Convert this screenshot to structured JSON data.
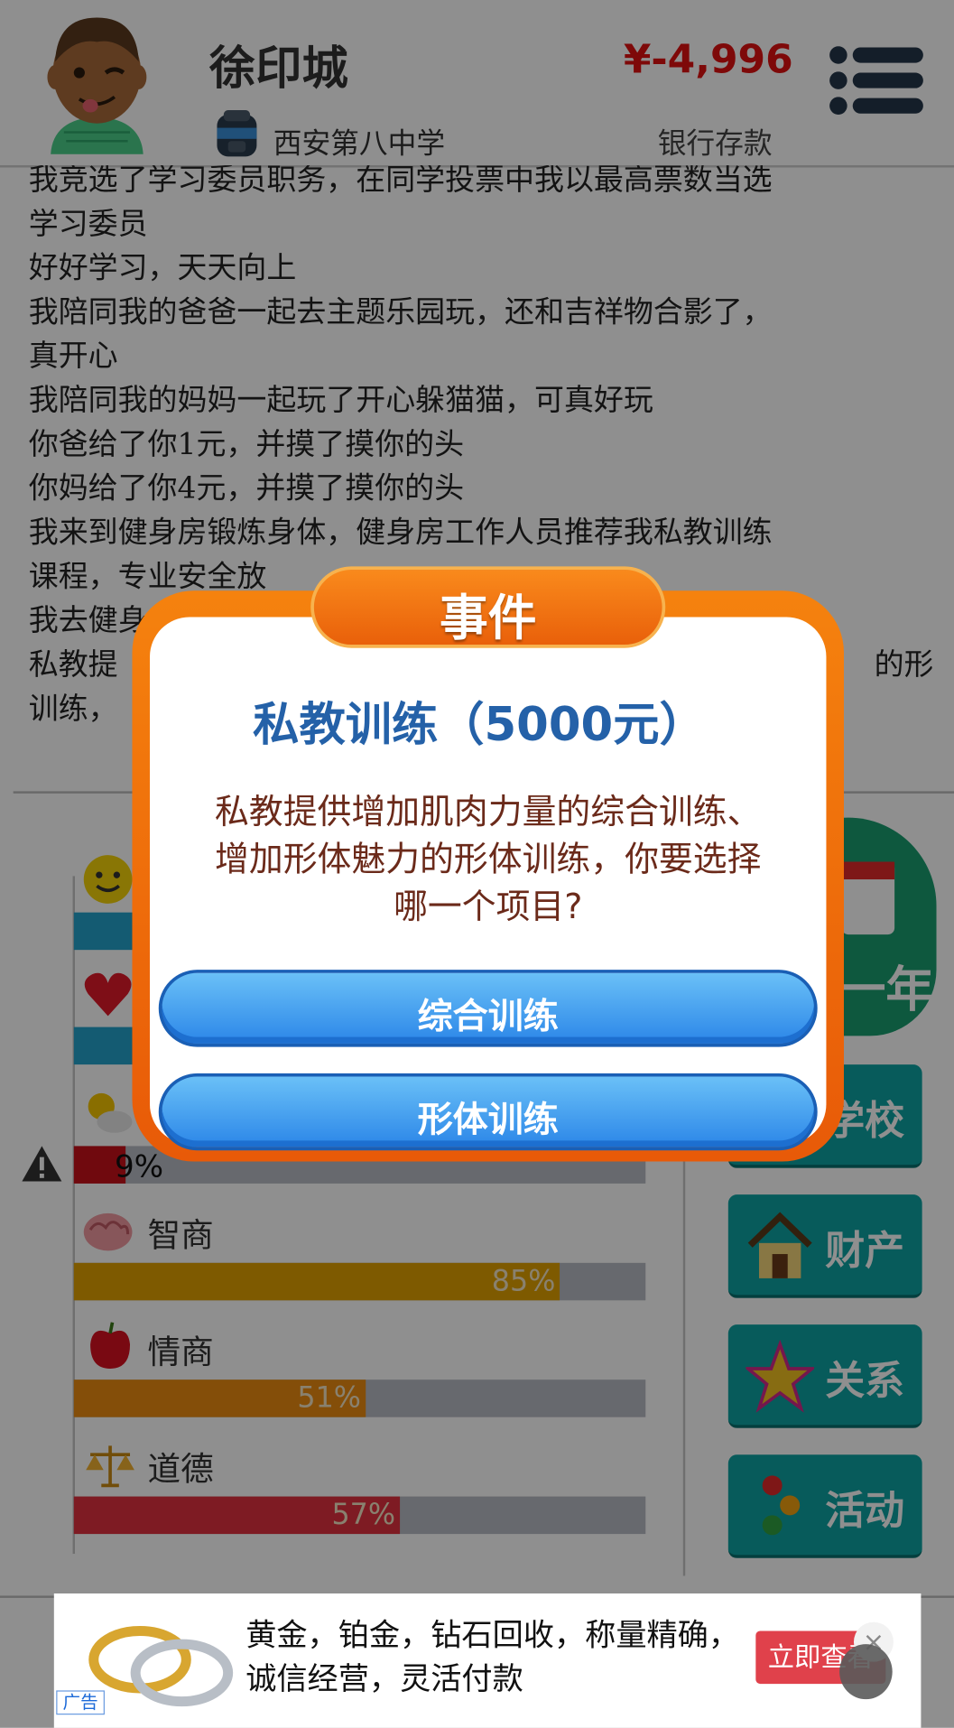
{
  "header": {
    "player_name": "徐印城",
    "school": "西安第八中学",
    "money": "¥-4,996",
    "money_label": "银行存款"
  },
  "log": [
    "我竞选了学习委员职务，在同学投票中我以最高票数当选",
    "学习委员",
    "好好学习，天天向上",
    "我陪同我的爸爸一起去主题乐园玩，还和吉祥物合影了，",
    "真开心",
    "我陪同我的妈妈一起玩了开心躲猫猫，可真好玩",
    "你爸给了你1元，并摸了摸你的头",
    "你妈给了你4元，并摸了摸你的头",
    "我来到健身房锻炼身体，健身房工作人员推荐我私教训练",
    "课程，专业安全放",
    "我去健身",
    "私教提                                                                                的形体",
    "训练，"
  ],
  "stats": {
    "low_value": "9%",
    "items": [
      {
        "label": "智商",
        "pct_text": "85%",
        "value": 0.85,
        "color": "#e0a000"
      },
      {
        "label": "情商",
        "pct_text": "51%",
        "value": 0.51,
        "color": "#eb8b10"
      },
      {
        "label": "道德",
        "pct_text": "57%",
        "value": 0.57,
        "color": "#e0313f"
      }
    ]
  },
  "side_buttons": {
    "year": "一年",
    "school": "学校",
    "property": "财产",
    "relations": "关系",
    "activity": "活动"
  },
  "dialog": {
    "title": "事件",
    "event_name": "私教训练（5000元）",
    "description": "私教提供增加肌肉力量的综合训练、增加形体魅力的形体训练，你要选择哪一个项目?",
    "options": [
      "综合训练",
      "形体训练"
    ]
  },
  "ad": {
    "text": "黄金，铂金，钻石回收，称量精确，诚信经营，灵活付款",
    "cta": "立即查看",
    "tag": "广告",
    "close": "×"
  }
}
